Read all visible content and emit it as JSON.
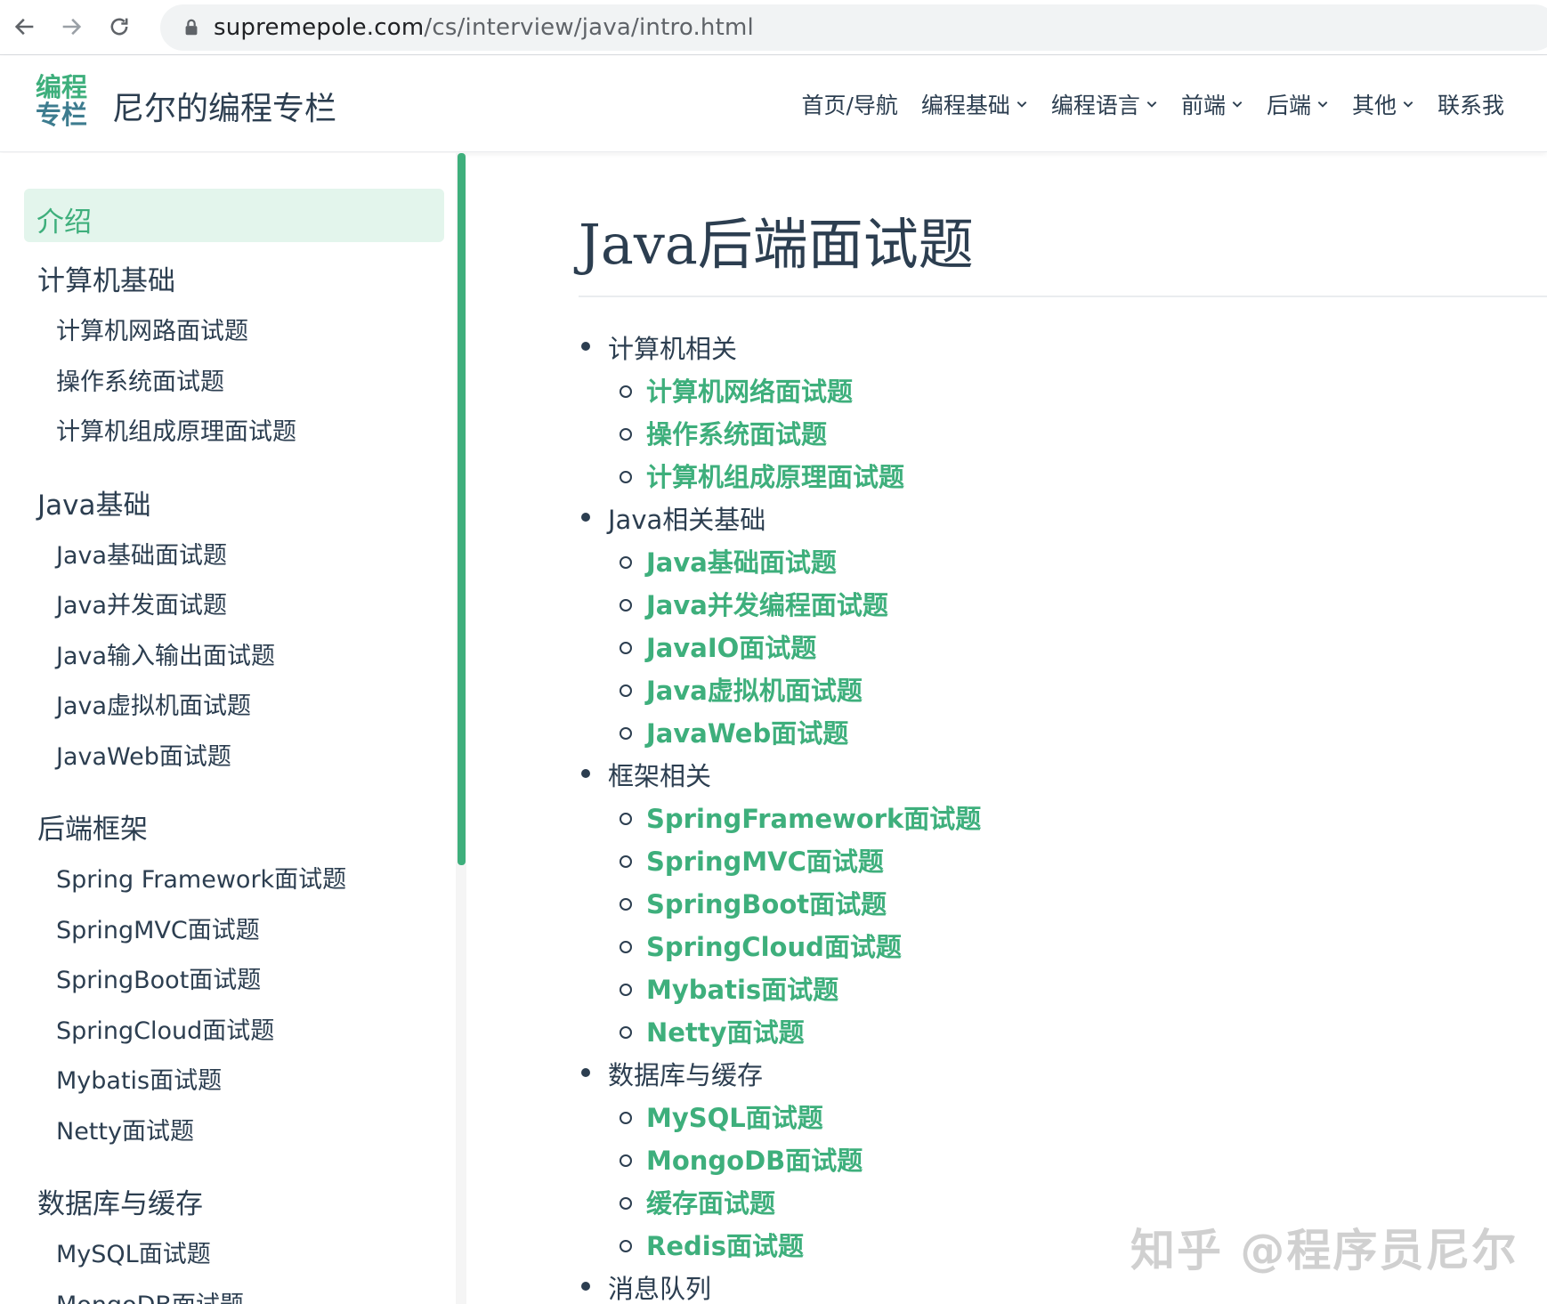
{
  "browser": {
    "url_domain": "supremepole.com",
    "url_path": "/cs/interview/java/intro.html"
  },
  "navbar": {
    "logo_line1": "编程",
    "logo_line2": "专栏",
    "site_title": "尼尔的编程专栏",
    "links": [
      {
        "label": "首页/导航",
        "dropdown": false
      },
      {
        "label": "编程基础",
        "dropdown": true
      },
      {
        "label": "编程语言",
        "dropdown": true
      },
      {
        "label": "前端",
        "dropdown": true
      },
      {
        "label": "后端",
        "dropdown": true
      },
      {
        "label": "其他",
        "dropdown": true
      },
      {
        "label": "联系我",
        "dropdown": false
      }
    ]
  },
  "sidebar": {
    "active": "介绍",
    "sections": [
      {
        "title": "计算机基础",
        "items": [
          "计算机网路面试题",
          "操作系统面试题",
          "计算机组成原理面试题"
        ]
      },
      {
        "title": "Java基础",
        "items": [
          "Java基础面试题",
          "Java并发面试题",
          "Java输入输出面试题",
          "Java虚拟机面试题",
          "JavaWeb面试题"
        ]
      },
      {
        "title": "后端框架",
        "items": [
          "Spring Framework面试题",
          "SpringMVC面试题",
          "SpringBoot面试题",
          "SpringCloud面试题",
          "Mybatis面试题",
          "Netty面试题"
        ]
      },
      {
        "title": "数据库与缓存",
        "items": [
          "MySQL面试题",
          "MongoDB面试题"
        ]
      }
    ]
  },
  "main": {
    "title": "Java后端面试题",
    "categories": [
      {
        "label": "计算机相关",
        "links": [
          "计算机网络面试题",
          "操作系统面试题",
          "计算机组成原理面试题"
        ]
      },
      {
        "label": "Java相关基础",
        "links": [
          "Java基础面试题",
          "Java并发编程面试题",
          "JavaIO面试题",
          "Java虚拟机面试题",
          "JavaWeb面试题"
        ]
      },
      {
        "label": "框架相关",
        "links": [
          "SpringFramework面试题",
          "SpringMVC面试题",
          "SpringBoot面试题",
          "SpringCloud面试题",
          "Mybatis面试题",
          "Netty面试题"
        ]
      },
      {
        "label": "数据库与缓存",
        "links": [
          "MySQL面试题",
          "MongoDB面试题",
          "缓存面试题",
          "Redis面试题"
        ]
      },
      {
        "label": "消息队列",
        "links": []
      }
    ]
  },
  "watermark": "知乎 @程序员尼尔",
  "colors": {
    "accent": "#3eaf7c",
    "text": "#2c3e50"
  }
}
